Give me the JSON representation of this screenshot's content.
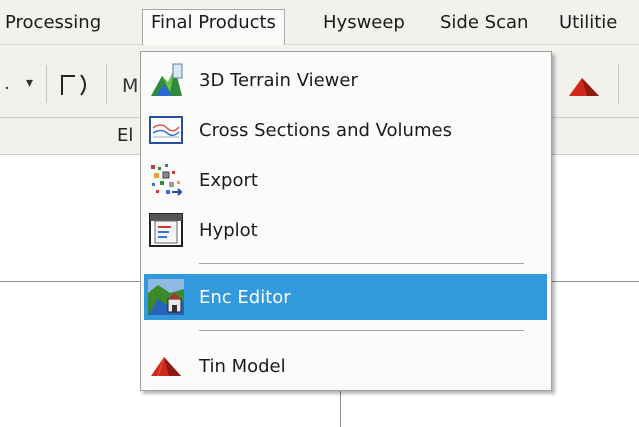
{
  "menubar": {
    "items": [
      "Processing",
      "Final Products",
      "Hysweep",
      "Side Scan",
      "Utilitie"
    ]
  },
  "toolbar": {
    "partial_button": "M",
    "dropdown_glyph": "▾"
  },
  "subbar": {
    "partial_label": "El"
  },
  "dropdown": {
    "items": [
      {
        "label": "3D Terrain Viewer",
        "icon": "terrain-3d-icon"
      },
      {
        "label": "Cross Sections and Volumes",
        "icon": "cross-sections-icon"
      },
      {
        "label": "Export",
        "icon": "export-icon"
      },
      {
        "label": "Hyplot",
        "icon": "hyplot-icon"
      },
      {
        "label": "Enc Editor",
        "icon": "enc-editor-icon",
        "highlighted": true
      },
      {
        "label": "Tin Model",
        "icon": "tin-model-icon"
      }
    ]
  },
  "colors": {
    "highlight": "#3399dd",
    "menubar_bg": "#f2f1ee",
    "tin_red": "#d0281c"
  }
}
